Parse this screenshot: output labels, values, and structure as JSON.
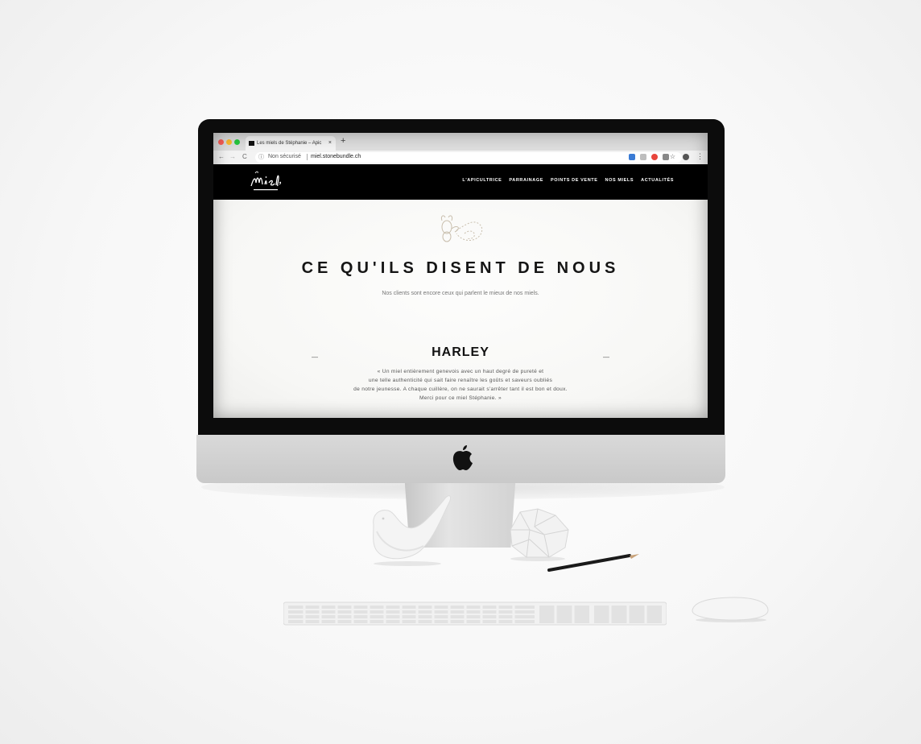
{
  "browser": {
    "tab_title": "Les miels de Stéphanie – Apic",
    "tab_close": "×",
    "new_tab": "+",
    "back": "←",
    "forward": "→",
    "reload": "C",
    "security_label": "Non sécurisé",
    "url": "miel.stonebundle.ch",
    "bookmark_star": "☆",
    "menu": "⋮"
  },
  "site": {
    "nav": [
      "L'APICULTRICE",
      "PARRAINAGE",
      "POINTS DE VENTE",
      "NOS MIELS",
      "ACTUALITÉS"
    ],
    "heading": "CE QU'ILS DISENT DE NOUS",
    "subheading": "Nos clients sont encore ceux qui parlent le mieux de nos miels.",
    "testimonial": {
      "name": "HARLEY",
      "lines": [
        "« Un miel entièrement genevois avec un haut degré de pureté et",
        "une telle authenticité qui sait faire renaître les goûts et saveurs oubliés",
        "de notre jeunesse. A chaque cuillère, on ne saurait s'arrêter tant il est bon et doux.",
        "Merci pour ce miel Stéphanie. »"
      ],
      "prev": "—",
      "next": "—"
    }
  },
  "colors": {
    "header_bg": "#000000",
    "heading": "#151515",
    "body_text": "#555555"
  }
}
